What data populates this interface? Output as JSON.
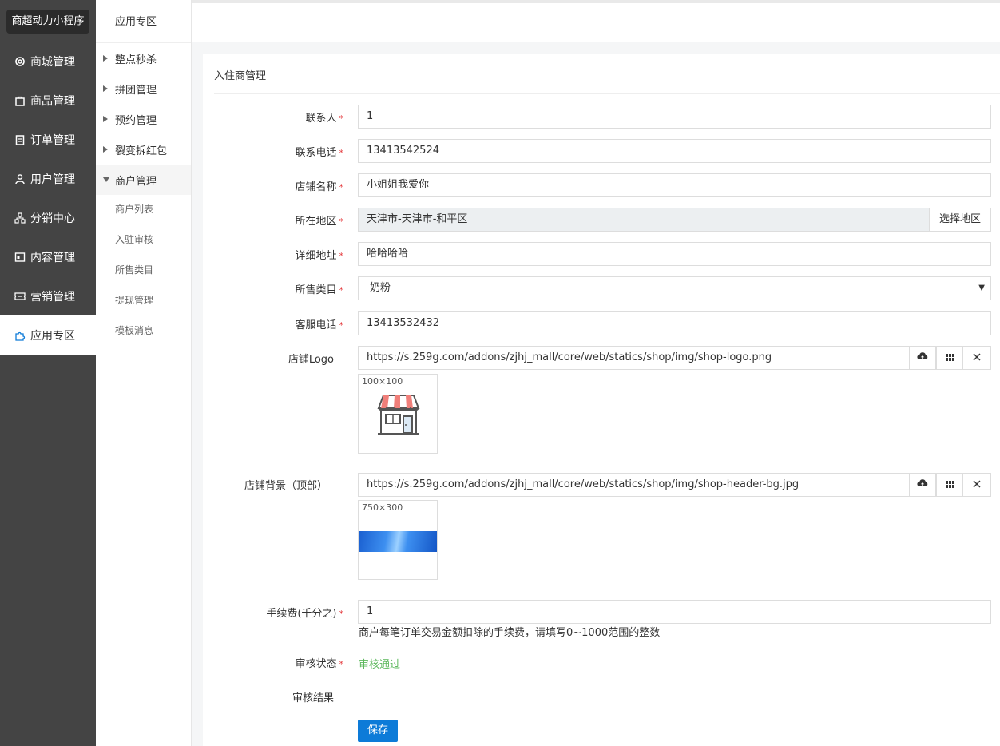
{
  "brand": "商超动力小程序",
  "nav": [
    "商城管理",
    "商品管理",
    "订单管理",
    "用户管理",
    "分销中心",
    "内容管理",
    "营销管理",
    "应用专区"
  ],
  "subnav": {
    "title": "应用专区",
    "groups": [
      "整点秒杀",
      "拼团管理",
      "预约管理",
      "裂变拆红包",
      "商户管理"
    ],
    "leaves": [
      "商户列表",
      "入驻审核",
      "所售类目",
      "提现管理",
      "模板消息"
    ]
  },
  "panel": {
    "title": "入住商管理"
  },
  "form": {
    "contact": {
      "label": "联系人",
      "value": "1"
    },
    "phone": {
      "label": "联系电话",
      "value": "13413542524"
    },
    "shop_name": {
      "label": "店铺名称",
      "value": "小姐姐我爱你"
    },
    "region": {
      "label": "所在地区",
      "value": "天津市-天津市-和平区",
      "button": "选择地区"
    },
    "address": {
      "label": "详细地址",
      "value": "哈哈哈哈"
    },
    "category": {
      "label": "所售类目",
      "value": "奶粉"
    },
    "service_phone": {
      "label": "客服电话",
      "value": "13413532432"
    },
    "logo": {
      "label": "店铺Logo",
      "url": "https://s.259g.com/addons/zjhj_mall/core/web/statics/shop/img/shop-logo.png",
      "dim": "100×100"
    },
    "bg": {
      "label": "店铺背景（顶部）",
      "url": "https://s.259g.com/addons/zjhj_mall/core/web/statics/shop/img/shop-header-bg.jpg",
      "dim": "750×300"
    },
    "fee": {
      "label": "手续费(千分之)",
      "value": "1",
      "help": "商户每笔订单交易金额扣除的手续费，请填写0~1000范围的整数"
    },
    "audit_status": {
      "label": "审核状态",
      "value": "审核通过"
    },
    "audit_result": {
      "label": "审核结果"
    },
    "save": "保存"
  },
  "required_mark": "*",
  "colors": {
    "accent": "#0d7bd8",
    "success": "#5cb85c",
    "required": "#e4393c",
    "sidebar": "#444444"
  }
}
